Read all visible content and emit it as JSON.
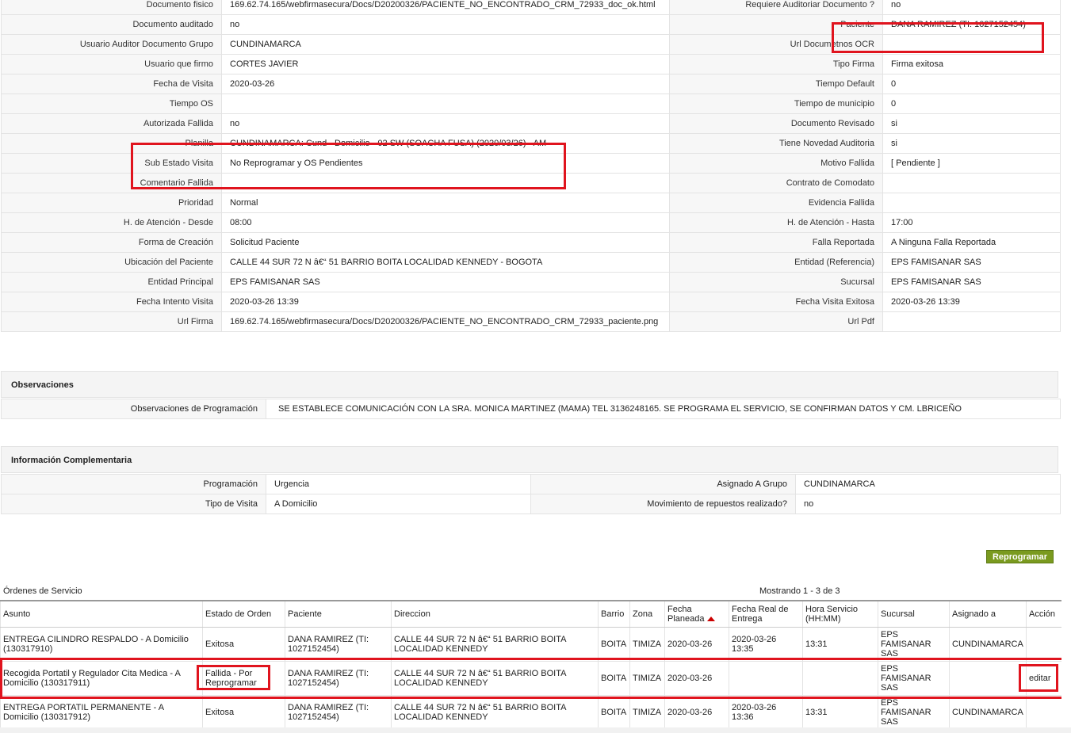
{
  "details": [
    {
      "l_label": "Documento fisico",
      "l_value": " 169.62.74.165/webfirmasecura/Docs/D20200326/PACIENTE_NO_ENCONTRADO_CRM_72933_doc_ok.html",
      "r_label": "Requiere Auditoriar Documento ?",
      "r_value": " no"
    },
    {
      "l_label": "Documento auditado",
      "l_value": " no",
      "r_label": "Paciente",
      "r_value": "DANA RAMIREZ (TI: 1027152454)"
    },
    {
      "l_label": "Usuario Auditor Documento Grupo",
      "l_value": "CUNDINAMARCA",
      "r_label": "Url Documetnos OCR",
      "r_value": ""
    },
    {
      "l_label": "Usuario que firmo",
      "l_value": "CORTES JAVIER",
      "r_label": "Tipo Firma",
      "r_value": "Firma exitosa"
    },
    {
      "l_label": "Fecha de Visita",
      "l_value": " 2020-03-26",
      "r_label": "Tiempo Default",
      "r_value": "0"
    },
    {
      "l_label": "Tiempo OS",
      "l_value": "",
      "r_label": "Tiempo de municipio",
      "r_value": "0"
    },
    {
      "l_label": "Autorizada Fallida",
      "l_value": " no",
      "r_label": "Documento Revisado",
      "r_value": " si"
    },
    {
      "l_label": "Planilla",
      "l_value": "CUNDINAMARCA: Cund - Domicilio - 02 SW (SOACHA FUSA) (2020/03/26) - AM",
      "r_label": "Tiene Novedad Auditoria",
      "r_value": " si"
    },
    {
      "l_label": "Sub Estado Visita",
      "l_value": "No Reprogramar y OS Pendientes",
      "r_label": "Motivo Fallida",
      "r_value": "[ Pendiente ]"
    },
    {
      "l_label": "Comentario Fallida",
      "l_value": "",
      "r_label": "Contrato de Comodato",
      "r_value": ""
    },
    {
      "l_label": "Prioridad",
      "l_value": "Normal",
      "r_label": "Evidencia Fallida",
      "r_value": ""
    },
    {
      "l_label": "H. de Atención - Desde",
      "l_value": "08:00",
      "r_label": "H. de Atención - Hasta",
      "r_value": "17:00"
    },
    {
      "l_label": "Forma de Creación",
      "l_value": "Solicitud Paciente",
      "r_label": "Falla Reportada",
      "r_value": "A Ninguna Falla Reportada"
    },
    {
      "l_label": "Ubicación del Paciente",
      "l_value": "CALLE 44 SUR 72 N â€“ 51 BARRIO BOITA LOCALIDAD KENNEDY - BOGOTA",
      "r_label": "Entidad (Referencia)",
      "r_value": "EPS FAMISANAR SAS"
    },
    {
      "l_label": "Entidad Principal",
      "l_value": "EPS FAMISANAR SAS",
      "r_label": "Sucursal",
      "r_value": "EPS FAMISANAR SAS"
    },
    {
      "l_label": "Fecha Intento Visita",
      "l_value": " 2020-03-26 13:39",
      "r_label": "Fecha Visita Exitosa",
      "r_value": " 2020-03-26 13:39"
    },
    {
      "l_label": "Url Firma",
      "l_value": " 169.62.74.165/webfirmasecura/Docs/D20200326/PACIENTE_NO_ENCONTRADO_CRM_72933_paciente.png",
      "r_label": "Url Pdf",
      "r_value": ""
    }
  ],
  "observaciones": {
    "title": "Observaciones",
    "label": "Observaciones de Programación",
    "value": "SE ESTABLECE COMUNICACIÓN CON LA SRA. MONICA MARTINEZ (MAMA) TEL 3136248165. SE PROGRAMA EL SERVICIO, SE CONFIRMAN DATOS Y CM. LBRICEÑO"
  },
  "complementaria": {
    "title": "Información Complementaria",
    "rows": [
      {
        "l_label": "Programación",
        "l_value": "Urgencia",
        "r_label": "Asignado A Grupo",
        "r_value": "CUNDINAMARCA"
      },
      {
        "l_label": "Tipo de Visita",
        "l_value": "A Domicilio",
        "r_label": "Movimiento de repuestos realizado?",
        "r_value": " no"
      }
    ]
  },
  "reprogramar_label": "Reprogramar",
  "orders": {
    "title": "Órdenes de Servicio",
    "showing": "Mostrando 1 - 3 de 3",
    "headers": {
      "asunto": "Asunto",
      "estado": "Estado de Orden",
      "paciente": "Paciente",
      "direccion": "Direccion",
      "barrio": "Barrio",
      "zona": "Zona",
      "fecha_planeada": "Fecha Planeada",
      "fecha_real": "Fecha Real de Entrega",
      "hora": "Hora Servicio (HH:MM)",
      "sucursal": "Sucursal",
      "asignado": "Asignado a",
      "accion": "Acción"
    },
    "rows": [
      {
        "asunto": "ENTREGA CILINDRO RESPALDO - A Domicilio (130317910)",
        "estado": "Exitosa",
        "paciente": "DANA RAMIREZ (TI: 1027152454)",
        "direccion": "CALLE 44 SUR 72 N â€“ 51 BARRIO BOITA LOCALIDAD KENNEDY",
        "barrio": "BOITA",
        "zona": "TIMIZA",
        "fecha_planeada": "2020-03-26",
        "fecha_real": "2020-03-26 13:35",
        "hora": "13:31",
        "sucursal": "EPS FAMISANAR SAS",
        "asignado": "CUNDINAMARCA",
        "accion": ""
      },
      {
        "asunto": "Recogida Portatil y Regulador Cita Medica - A Domicilio (130317911)",
        "estado": "Fallida - Por Reprogramar",
        "paciente": "DANA RAMIREZ (TI: 1027152454)",
        "direccion": "CALLE 44 SUR 72 N â€“ 51 BARRIO BOITA LOCALIDAD KENNEDY",
        "barrio": "BOITA",
        "zona": "TIMIZA",
        "fecha_planeada": "2020-03-26",
        "fecha_real": "",
        "hora": "",
        "sucursal": "EPS FAMISANAR SAS",
        "asignado": "",
        "accion": "editar"
      },
      {
        "asunto": "ENTREGA PORTATIL PERMANENTE - A Domicilio (130317912)",
        "estado": "Exitosa",
        "paciente": "DANA RAMIREZ (TI: 1027152454)",
        "direccion": "CALLE 44 SUR 72 N â€“ 51 BARRIO BOITA LOCALIDAD KENNEDY",
        "barrio": "BOITA",
        "zona": "TIMIZA",
        "fecha_planeada": "2020-03-26",
        "fecha_real": "2020-03-26 13:36",
        "hora": "13:31",
        "sucursal": "EPS FAMISANAR SAS",
        "asignado": "CUNDINAMARCA",
        "accion": ""
      }
    ]
  },
  "colors": {
    "highlight": "#e0141e",
    "button": "#7a9a1f"
  }
}
